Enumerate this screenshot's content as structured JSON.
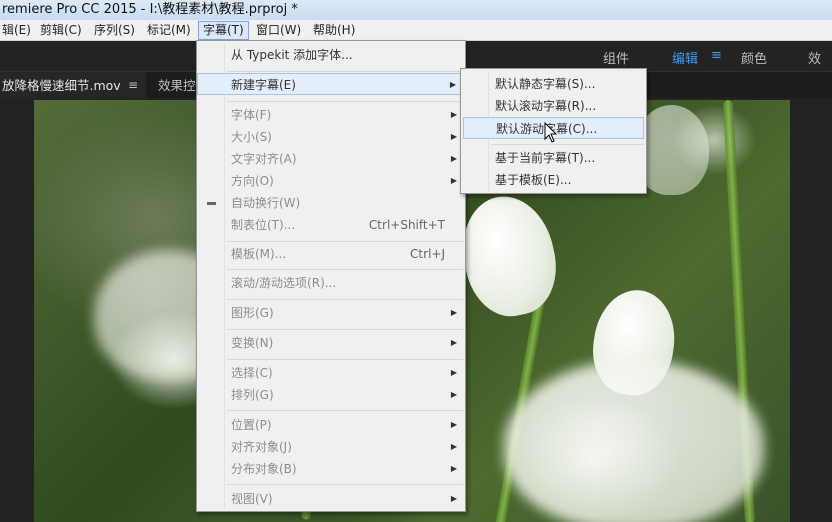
{
  "window": {
    "title": "remiere Pro CC 2015 - I:\\教程素材\\教程.prproj *"
  },
  "menubar": {
    "items": [
      "辑(E)",
      "剪辑(C)",
      "序列(S)",
      "标记(M)",
      "字幕(T)",
      "窗口(W)",
      "帮助(H)"
    ],
    "active_index": 4
  },
  "workspace": {
    "tabs": [
      "组件",
      "编辑",
      "颜色",
      "效果"
    ],
    "active": "编辑",
    "accent_color": "#3b9ef0"
  },
  "panels": {
    "tabs": [
      "放降格慢速细节.mov",
      "效果控"
    ],
    "menu_icon": "≡"
  },
  "title_menu": {
    "items": [
      {
        "label": "从 Typekit 添加字体...",
        "disabled": false,
        "submenu": false
      },
      {
        "label": "新建字幕(E)",
        "disabled": false,
        "submenu": true,
        "hover": true
      },
      {
        "label": "字体(F)",
        "disabled": true,
        "submenu": true
      },
      {
        "label": "大小(S)",
        "disabled": true,
        "submenu": true
      },
      {
        "label": "文字对齐(A)",
        "disabled": true,
        "submenu": true
      },
      {
        "label": "方向(O)",
        "disabled": true,
        "submenu": true
      },
      {
        "label": "自动换行(W)",
        "disabled": true,
        "submenu": false,
        "checked": true
      },
      {
        "label": "制表位(T)...",
        "disabled": true,
        "shortcut": "Ctrl+Shift+T"
      },
      {
        "label": "模板(M)...",
        "disabled": true,
        "shortcut": "Ctrl+J"
      },
      {
        "label": "滚动/游动选项(R)...",
        "disabled": true
      },
      {
        "label": "图形(G)",
        "disabled": true,
        "submenu": true
      },
      {
        "label": "变换(N)",
        "disabled": true,
        "submenu": true
      },
      {
        "label": "选择(C)",
        "disabled": true,
        "submenu": true
      },
      {
        "label": "排列(G)",
        "disabled": true,
        "submenu": true
      },
      {
        "label": "位置(P)",
        "disabled": true,
        "submenu": true
      },
      {
        "label": "对齐对象(J)",
        "disabled": true,
        "submenu": true
      },
      {
        "label": "分布对象(B)",
        "disabled": true,
        "submenu": true
      },
      {
        "label": "视图(V)",
        "disabled": true,
        "submenu": true
      }
    ]
  },
  "new_title_submenu": {
    "items": [
      {
        "label": "默认静态字幕(S)..."
      },
      {
        "label": "默认滚动字幕(R)..."
      },
      {
        "label": "默认游动字幕(C)...",
        "hover": true
      },
      {
        "label": "基于当前字幕(T)..."
      },
      {
        "label": "基于模板(E)..."
      }
    ]
  }
}
